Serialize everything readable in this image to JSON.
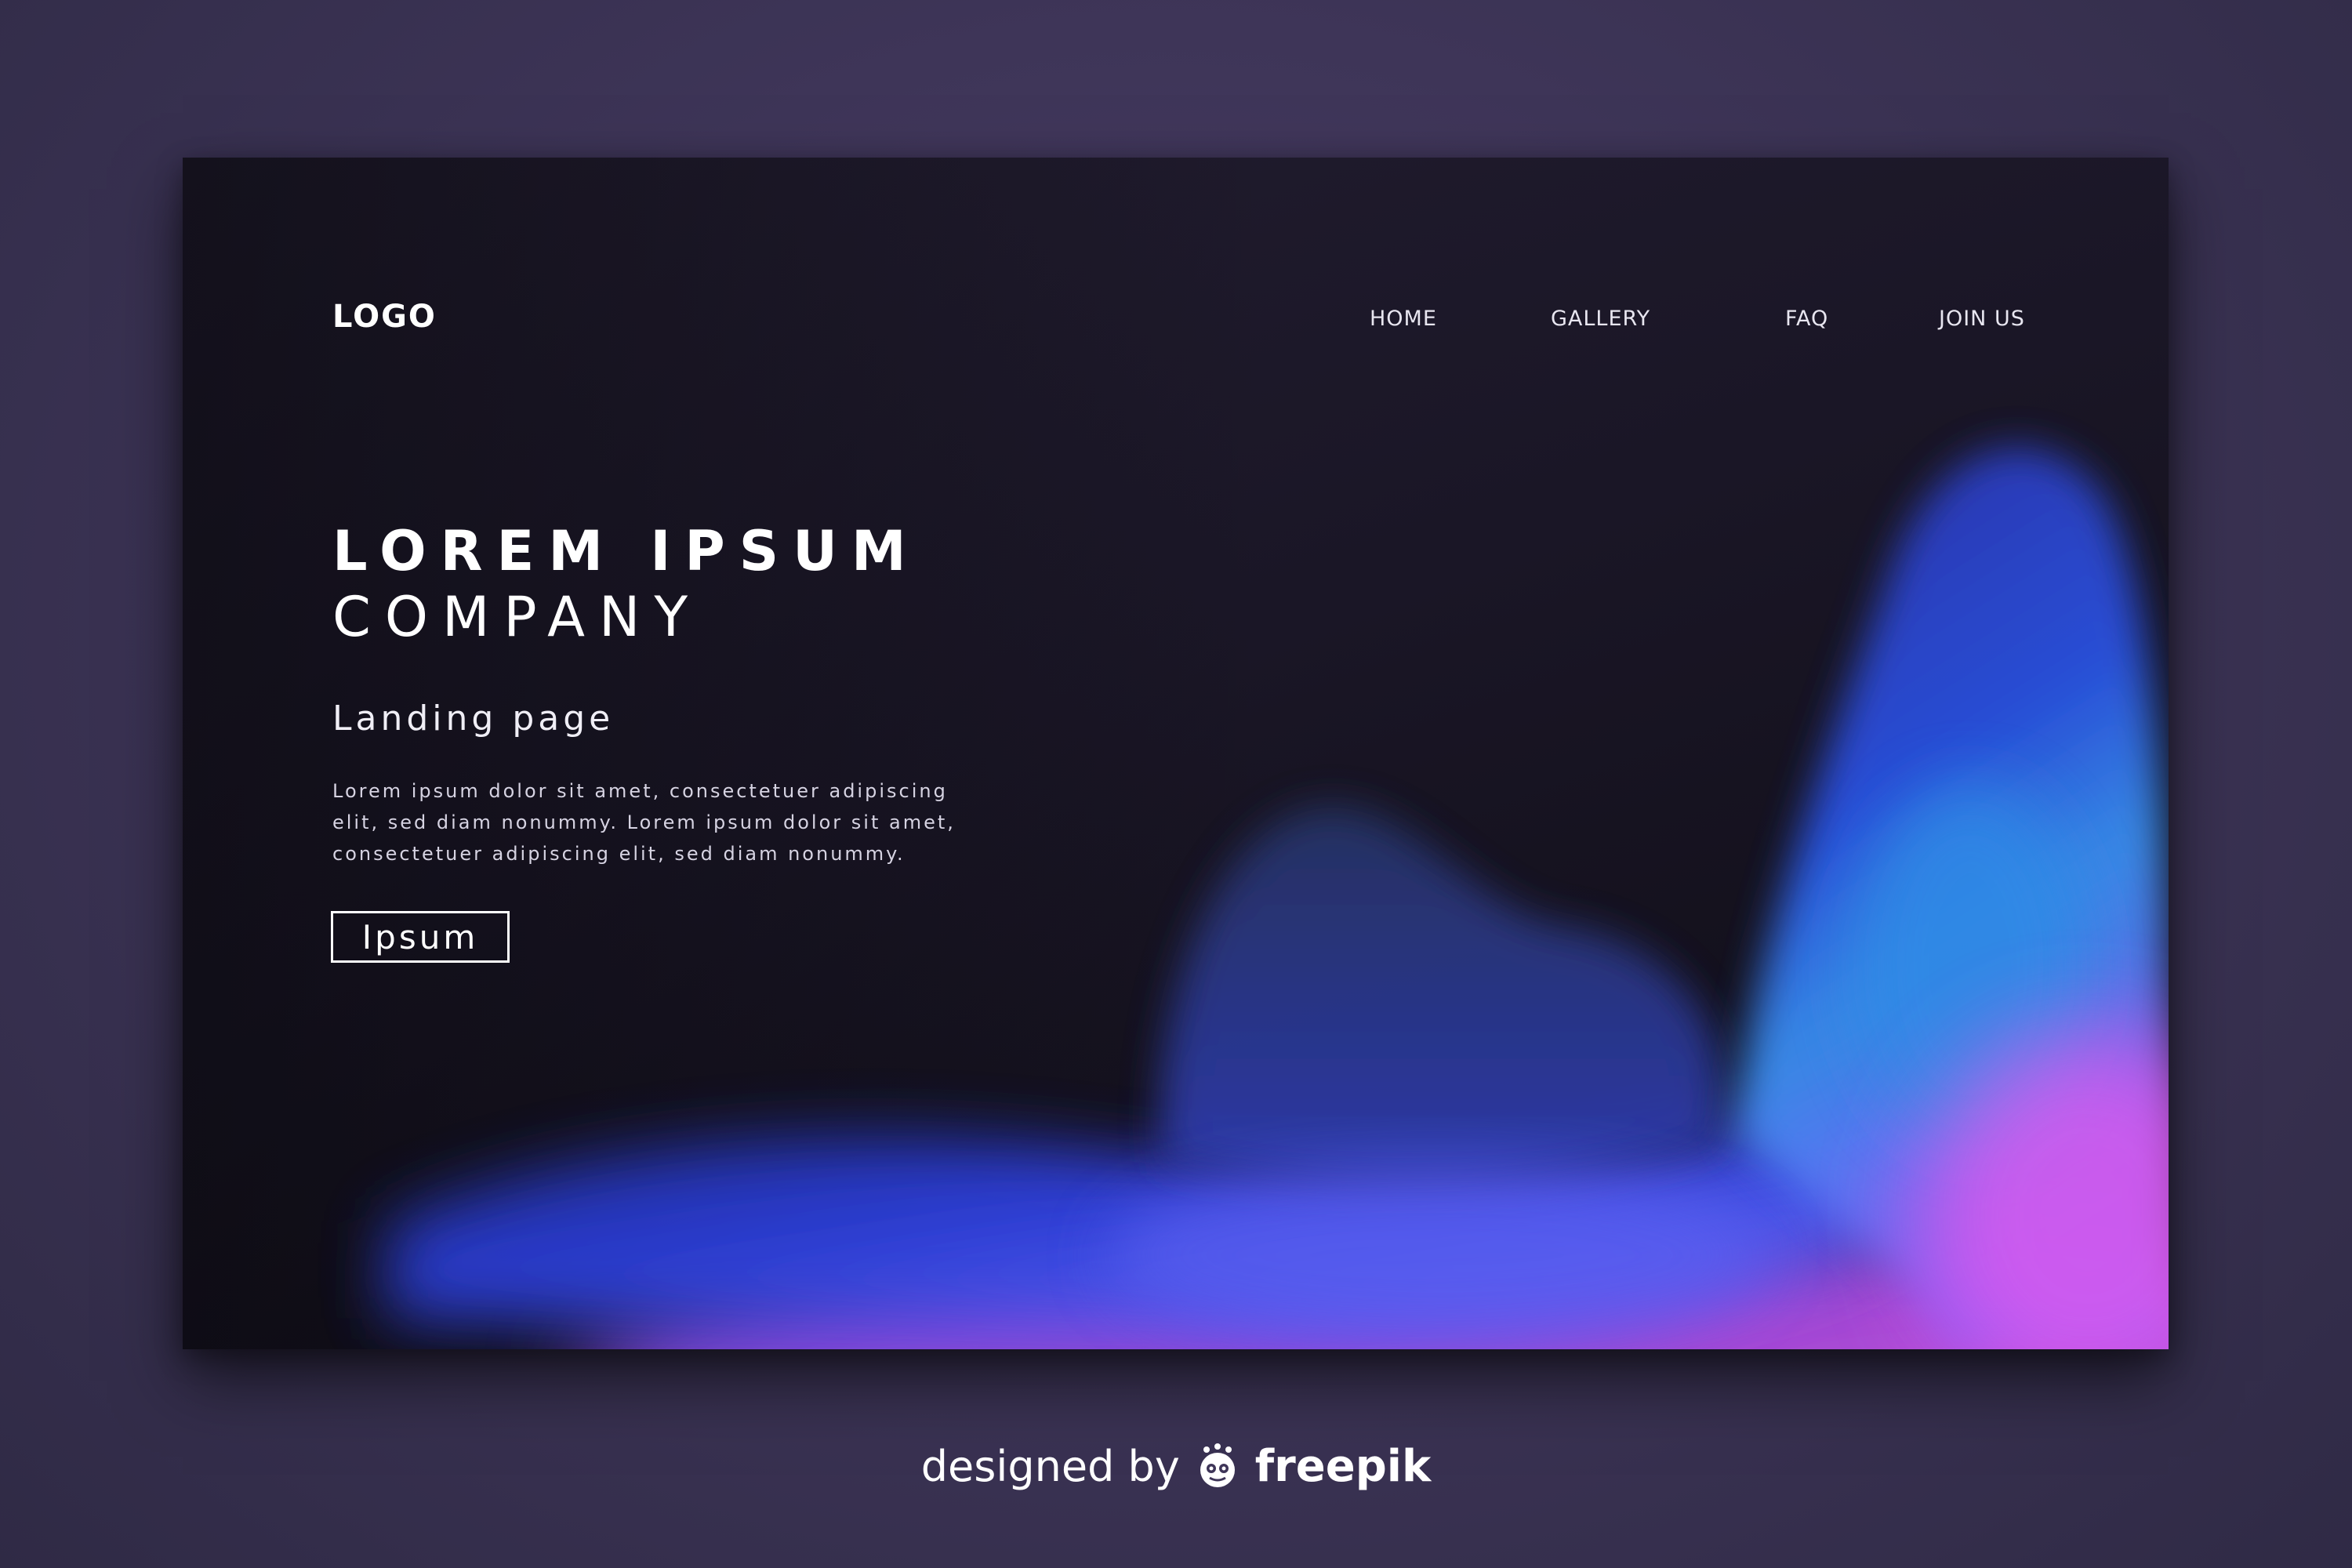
{
  "brand": {
    "logo_text": "LOGO"
  },
  "nav": {
    "items": [
      {
        "label": "HOME"
      },
      {
        "label": "GALLERY"
      },
      {
        "label": "FAQ"
      },
      {
        "label": "JOIN US"
      }
    ]
  },
  "hero": {
    "headline_line1": "LOREM IPSUM",
    "headline_line2": "COMPANY",
    "subtitle": "Landing page",
    "body": "Lorem ipsum dolor sit amet, consectetuer adipiscing elit, sed diam nonummy. Lorem ipsum dolor sit amet, consectetuer adipiscing elit, sed diam nonummy.",
    "button_label": "Ipsum"
  },
  "credit": {
    "prefix": "designed by",
    "brand": "freepik",
    "icon": "freepik-mascot-icon"
  },
  "colors": {
    "page_background": "#3e3558",
    "card_background": "#1a1626",
    "blob_blue": "#2f3fd8",
    "blob_cyan": "#2f8ae6",
    "blob_violet": "#7a4ee6",
    "blob_magenta": "#f25df0",
    "text": "#ffffff"
  }
}
